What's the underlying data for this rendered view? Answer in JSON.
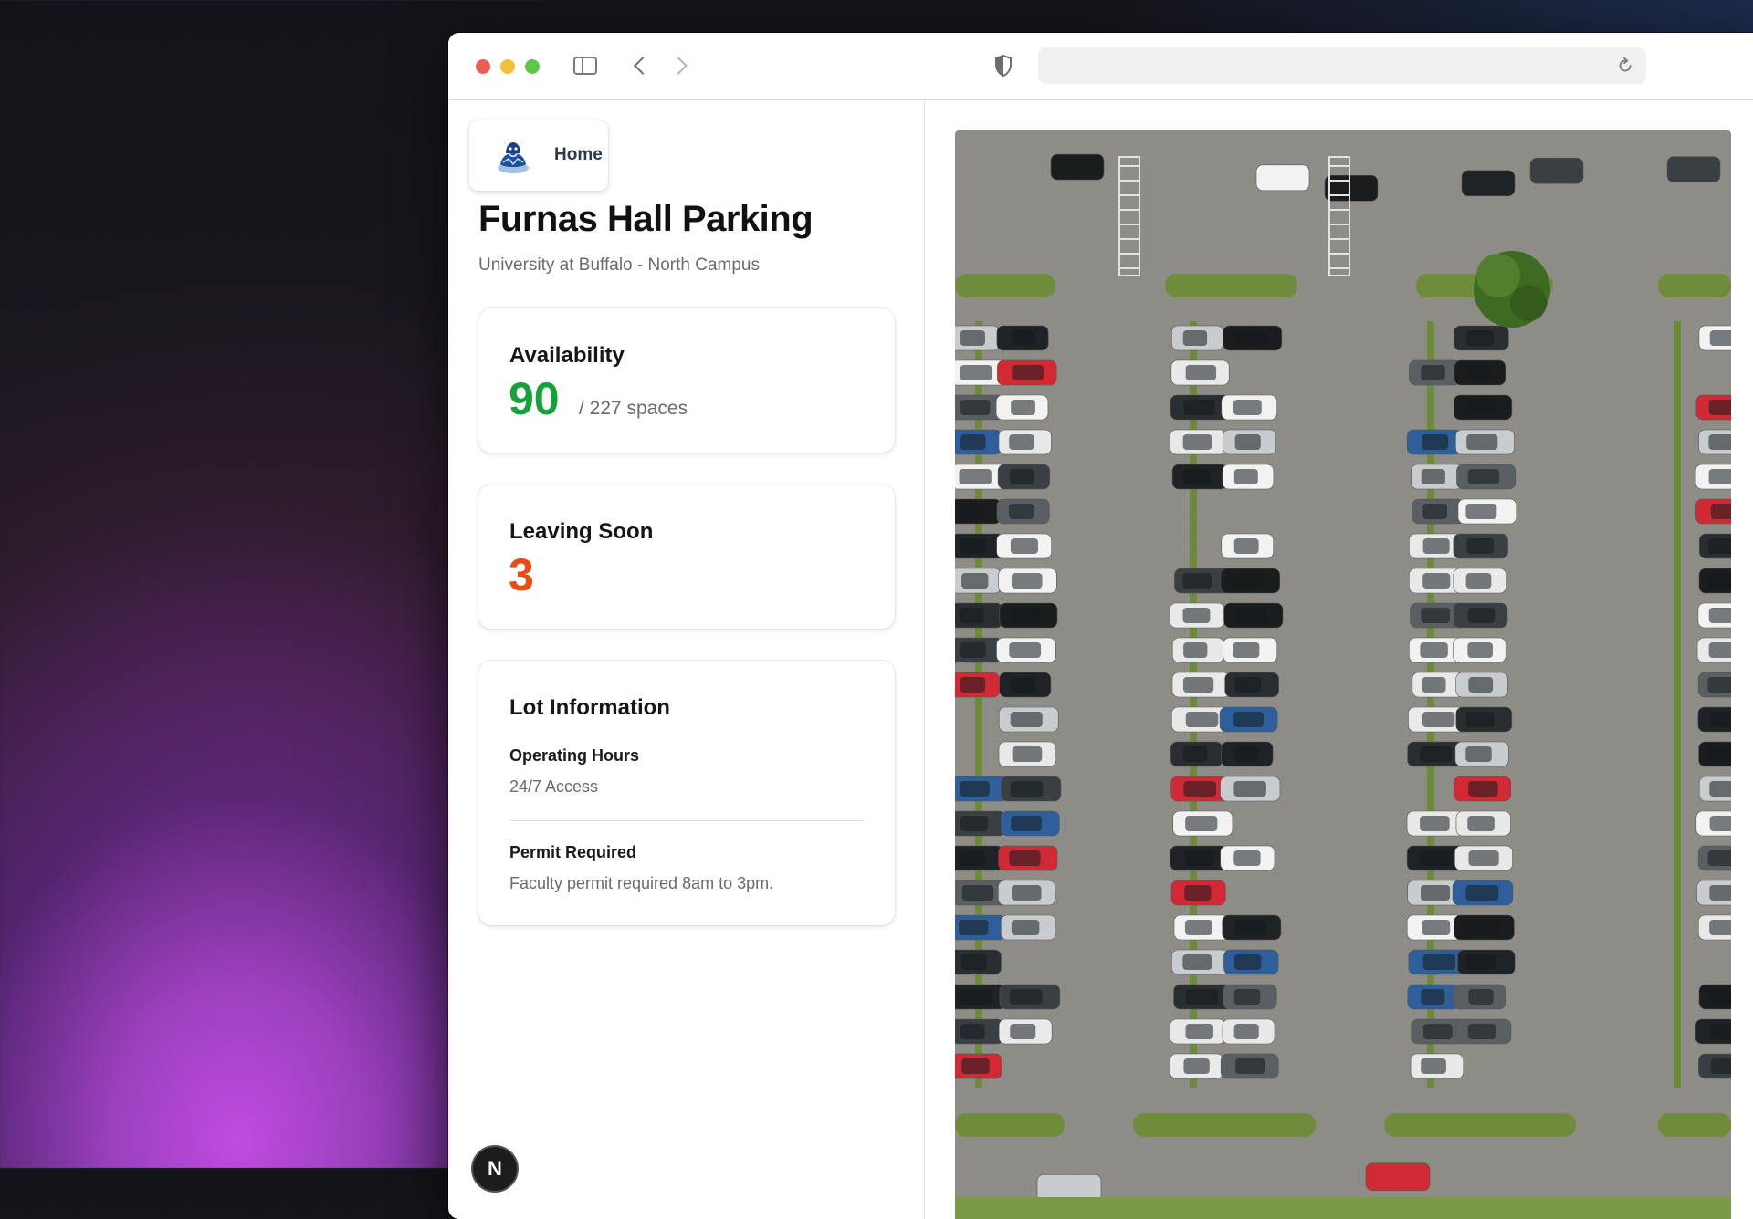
{
  "browser": {
    "address": "",
    "icons": {
      "sidebar": "sidebar-toggle-icon",
      "back": "chevron-left-icon",
      "forward": "chevron-right-icon",
      "privacy": "shield-icon",
      "reload": "reload-icon"
    }
  },
  "nav": {
    "home_label": "Home",
    "logo": "bull-mascot-logo"
  },
  "page": {
    "title": "Furnas Hall Parking",
    "subtitle": "University at Buffalo - North Campus"
  },
  "availability": {
    "title": "Availability",
    "available": "90",
    "total_text": "/ 227 spaces",
    "color": "#17a13a"
  },
  "leaving": {
    "title": "Leaving Soon",
    "count": "3",
    "color": "#ec4a12"
  },
  "lot": {
    "title": "Lot Information",
    "hours_label": "Operating Hours",
    "hours_value": "24/7 Access",
    "permit_label": "Permit Required",
    "permit_value": "Faculty permit required 8am to 3pm."
  },
  "dev_badge": {
    "letter": "N"
  },
  "aerial": {
    "description_icon": "parking-lot-aerial-image"
  }
}
